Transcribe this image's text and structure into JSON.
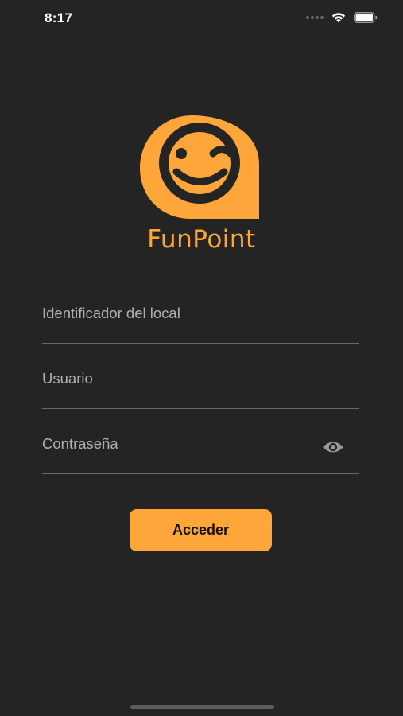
{
  "status_bar": {
    "time": "8:17",
    "wifi_icon": "wifi-icon",
    "battery_icon": "battery-icon"
  },
  "brand": {
    "name": "FunPoint",
    "logo_icon": "winking-face-bubble-icon",
    "color": "#FFA63A"
  },
  "form": {
    "local_id_label": "Identificador del local",
    "user_label": "Usuario",
    "password_label": "Contraseña",
    "toggle_icon": "eye-icon",
    "submit_label": "Acceder"
  },
  "colors": {
    "background": "#242424",
    "accent": "#FFA63A",
    "field_label": "#b0b0b0",
    "divider": "#6a6a6a"
  }
}
